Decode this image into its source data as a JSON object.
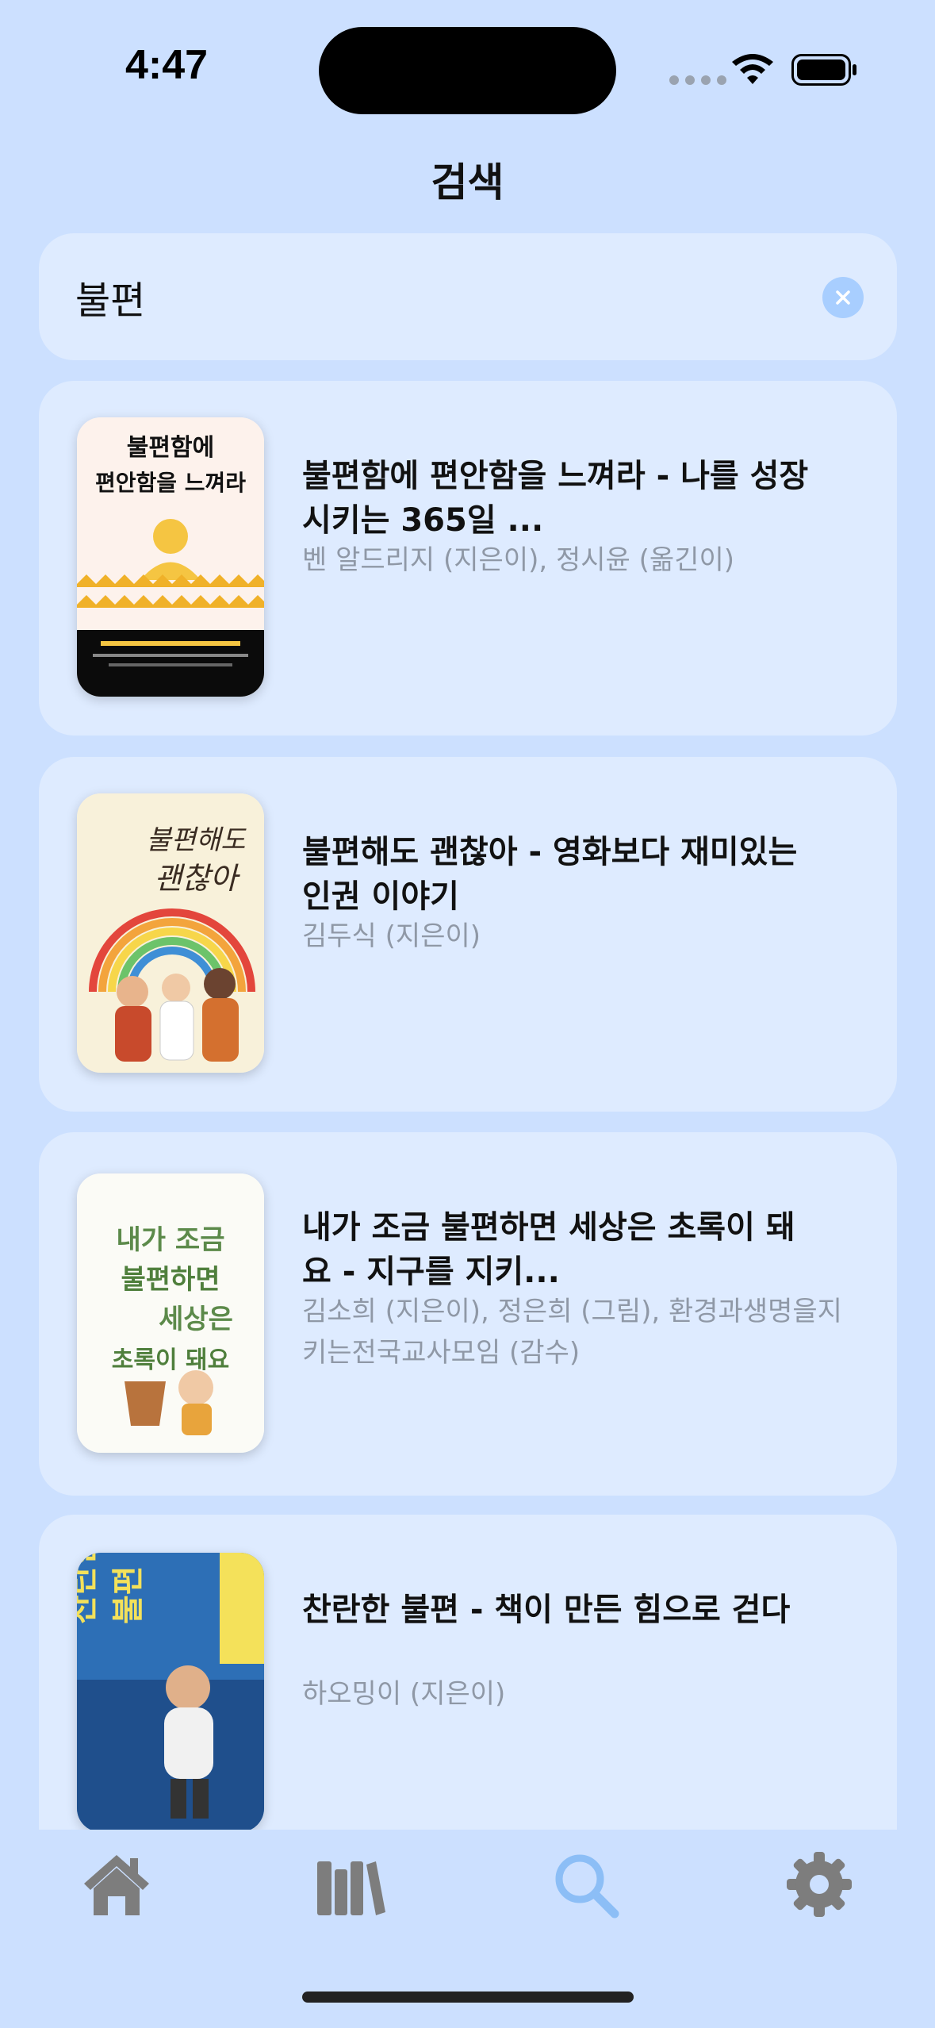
{
  "status_bar": {
    "time": "4:47"
  },
  "header": {
    "title": "검색"
  },
  "search": {
    "value": "불편",
    "clear_icon": "xmark-circle-icon"
  },
  "results": [
    {
      "title": "불편함에 편안함을 느껴라 - 나를 성장시키는 365일 ...",
      "authors": "벤 알드리지 (지은이), 정시윤 (옮긴이)",
      "cover_text": [
        "불편함에",
        "편안함을 느껴라"
      ]
    },
    {
      "title": "불편해도 괜찮아 - 영화보다 재미있는 인권 이야기",
      "authors": "김두식 (지은이)",
      "cover_text": [
        "불편해도",
        "괜찮아"
      ]
    },
    {
      "title": "내가 조금 불편하면 세상은 초록이 돼요 - 지구를 지키...",
      "authors": "김소희 (지은이), 정은희 (그림), 환경과생명을지키는전국교사모임 (감수)",
      "cover_text": [
        "내가 조금",
        "불편하면",
        "세상은",
        "초록이 돼요"
      ]
    },
    {
      "title": "찬란한 불편 - 책이 만든 힘으로 걷다",
      "authors": "하오밍이 (지은이)",
      "cover_text": [
        "찬란한",
        "불편"
      ]
    }
  ],
  "tab_bar": {
    "items": [
      {
        "name": "home",
        "icon": "house-icon",
        "selected": false
      },
      {
        "name": "library",
        "icon": "books-icon",
        "selected": false
      },
      {
        "name": "search",
        "icon": "magnifyingglass-icon",
        "selected": true
      },
      {
        "name": "settings",
        "icon": "gear-icon",
        "selected": false
      }
    ]
  },
  "colors": {
    "background": "#cce0ff",
    "card": "#deebff",
    "selected_tab": "#8cbef6",
    "unselected_tab": "#7d7d7d",
    "secondary_text": "#8f98a6"
  }
}
